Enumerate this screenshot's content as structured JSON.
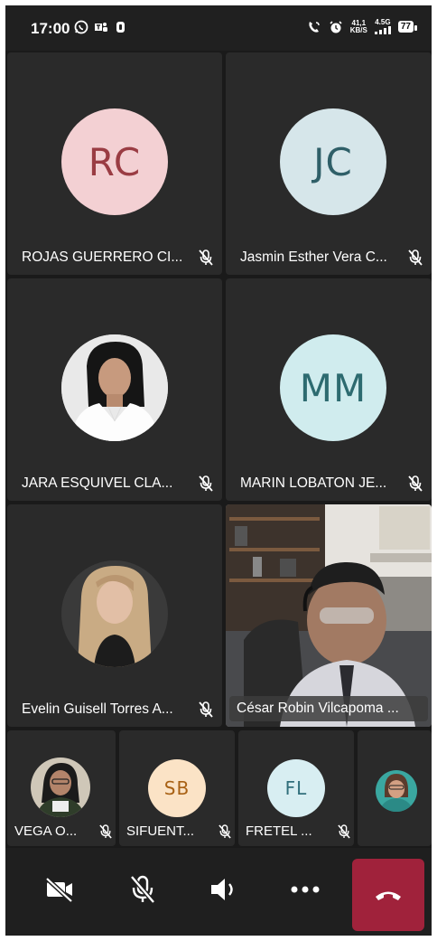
{
  "status_bar": {
    "time": "17:00",
    "left_icons": [
      "whatsapp-icon",
      "teams-icon",
      "app-icon"
    ],
    "net_speed_value": "41,1",
    "net_speed_unit": "KB/S",
    "network": "4.5G",
    "battery": "77"
  },
  "colors": {
    "rc_bg": "#f3d0d3",
    "rc_fg": "#9a3c43",
    "jc_bg": "#d6e6ea",
    "jc_fg": "#2f5f68",
    "mm_bg": "#d0ecee",
    "mm_fg": "#2d6b70",
    "sb_bg": "#fbe3c6",
    "sb_fg": "#a86114",
    "fl_bg": "#d8eef2",
    "fl_fg": "#316f7c",
    "end_call": "#a0223b"
  },
  "participants": {
    "rc": {
      "initials": "RC",
      "name": "ROJAS  GUERRERO CI..."
    },
    "jc": {
      "initials": "JC",
      "name": "Jasmin Esther Vera C..."
    },
    "jara": {
      "name": "JARA  ESQUIVEL CLA..."
    },
    "mm": {
      "initials": "MM",
      "name": "MARIN  LOBATON JE..."
    },
    "evelin": {
      "name": "Evelin Guisell Torres A..."
    },
    "cesar": {
      "name": "César Robin Vilcapoma ..."
    },
    "vega": {
      "name": "VEGA  O..."
    },
    "sb": {
      "initials": "SB",
      "name": "SIFUENT..."
    },
    "fl": {
      "initials": "FL",
      "name": "FRETEL  ..."
    }
  },
  "toolbar": {
    "buttons": [
      "camera-off-icon",
      "mic-off-icon",
      "speaker-icon",
      "more-icon",
      "end-call-icon"
    ]
  }
}
